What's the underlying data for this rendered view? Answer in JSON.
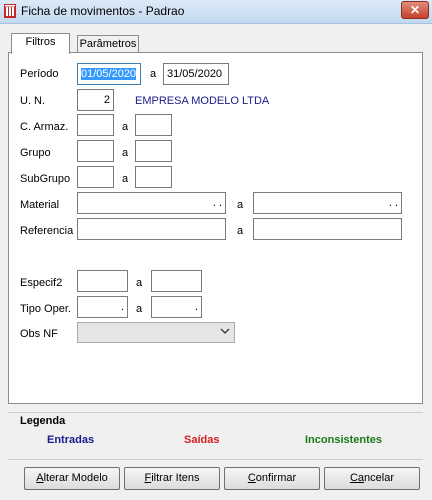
{
  "window": {
    "title": "Ficha de movimentos - Padrao",
    "close_symbol": "✕"
  },
  "tabs": [
    {
      "label": "Filtros",
      "active": true
    },
    {
      "label": "Parâmetros",
      "active": false
    }
  ],
  "form": {
    "periodo": {
      "label": "Período",
      "from": "01/05/2020",
      "sep": "a",
      "to": "31/05/2020"
    },
    "un": {
      "label": "U. N.",
      "value": "2",
      "company": "EMPRESA MODELO LTDA"
    },
    "c_armaz": {
      "label": "C. Armaz.",
      "sep": "a"
    },
    "grupo": {
      "label": "Grupo",
      "sep": "a"
    },
    "subgrupo": {
      "label": "SubGrupo",
      "sep": "a"
    },
    "material": {
      "label": "Material",
      "sep": "a",
      "from_mask": ". .",
      "to_mask": ". ."
    },
    "referencia": {
      "label": "Referencia",
      "sep": "a"
    },
    "especif2": {
      "label": "Especif2",
      "sep": "a"
    },
    "tipo_oper": {
      "label": "Tipo Oper.",
      "sep": "a",
      "from_mask": ".",
      "to_mask": "."
    },
    "obs_nf": {
      "label": "Obs NF",
      "value": ""
    }
  },
  "legend": {
    "title": "Legenda",
    "items": [
      {
        "label": "Entradas",
        "color": "#1a1a8c"
      },
      {
        "label": "Saídas",
        "color": "#d42020"
      },
      {
        "label": "Inconsistentes",
        "color": "#1a7a1a"
      }
    ]
  },
  "buttons": [
    {
      "mnemonic": "A",
      "rest": "lterar Modelo"
    },
    {
      "mnemonic": "F",
      "rest": "iltrar Itens"
    },
    {
      "mnemonic": "C",
      "rest": "onfirmar"
    },
    {
      "mnemonic": "Ca",
      "rest": "ncelar"
    }
  ]
}
